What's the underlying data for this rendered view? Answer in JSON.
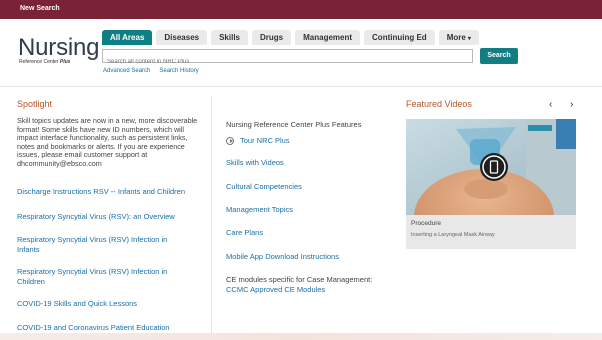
{
  "topbar": {
    "new_search": "New Search"
  },
  "logo": {
    "title": "Nursing",
    "subtitle_prefix": "Reference Center",
    "subtitle_suffix": "Plus"
  },
  "tabs": [
    {
      "label": "All Areas",
      "active": true
    },
    {
      "label": "Diseases"
    },
    {
      "label": "Skills"
    },
    {
      "label": "Drugs"
    },
    {
      "label": "Management"
    },
    {
      "label": "Continuing Ed"
    },
    {
      "label": "More"
    }
  ],
  "search": {
    "placeholder": "Search all content in NRC Plus",
    "button": "Search"
  },
  "sublinks": {
    "advanced": "Advanced Search",
    "history": "Search History"
  },
  "spotlight": {
    "title": "Spotlight",
    "intro": "Skill topics updates are now in a new, more discoverable format! Some skills have new ID numbers, which will impact interface functionality, such as persistent links, notes and bookmarks or alerts. If you are experience issues, please email customer support at dhcommunity@ebsco.com",
    "links": [
      "Discharge Instructions RSV -- Infants and Children",
      "Respiratory Syncytial Virus (RSV): an Overview",
      "Respiratory Syncytial Virus (RSV) Infection in Infants",
      "Respiratory Syncytial Virus (RSV) Infection in Children",
      "COVID-19 Skills and Quick Lessons",
      "COVID-19 and Coronavirus Patient Education"
    ]
  },
  "features": {
    "title": "Nursing Reference Center Plus Features",
    "tour": "Tour NRC Plus",
    "links": [
      "Skills with Videos",
      "Cultural Competencies",
      "Management Topics",
      "Care Plans",
      "Mobile App Download Instructions"
    ],
    "ce_text": "CE modules specific for Case Management:",
    "ce_link": "CCMC Approved CE Modules"
  },
  "videos": {
    "title": "Featured Videos",
    "prev": "‹",
    "next": "›",
    "kind": "Procedure",
    "description": "Inserting a Laryngeal Mask Airway"
  },
  "colors": {
    "topbar": "#7a2337",
    "accent": "#0f7f86",
    "link": "#1a6fa6",
    "heading": "#b0562a"
  }
}
